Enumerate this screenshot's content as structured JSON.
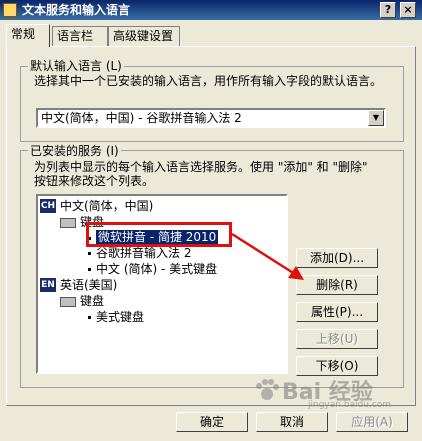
{
  "window": {
    "title": "文本服务和输入语言",
    "help_glyph": "?",
    "close_glyph": "×"
  },
  "tabs": [
    {
      "label": "常规",
      "active": true
    },
    {
      "label": "语言栏",
      "active": false
    },
    {
      "label": "高级键设置",
      "active": false
    }
  ],
  "default_group": {
    "label": "默认输入语言 (L)",
    "description": "选择其中一个已安装的输入语言，用作所有输入字段的默认语言。",
    "combo_value": "中文(简体，中国) - 谷歌拼音输入法 2"
  },
  "installed_group": {
    "label": "已安装的服务 (I)",
    "description_line1": "为列表中显示的每个输入语言选择服务。使用 \"添加\" 和 \"删除\"",
    "description_line2": "按钮来修改这个列表。"
  },
  "tree": {
    "lang1_code": "CH",
    "lang1": "中文(简体，中国)",
    "keyboard_label": "键盘",
    "items1": [
      "微软拼音 - 简捷 2010",
      "谷歌拼音输入法 2",
      "中文 (简体) - 美式键盘"
    ],
    "lang2_code": "EN",
    "lang2": "英语(美国)",
    "keyboard_label2": "键盘",
    "items2": [
      "美式键盘"
    ]
  },
  "buttons": {
    "add": "添加(D)...",
    "remove": "删除(R)",
    "properties": "属性(P)...",
    "move_up": "上移(U)",
    "move_down": "下移(O)",
    "ok": "确定",
    "cancel": "取消",
    "apply": "应用(A)"
  },
  "watermark": {
    "text": "Bai 经验",
    "sub": "jingyan.baidu.com"
  },
  "colors": {
    "annotation": "#e01010",
    "selection": "#0a246a",
    "titlebar": "#0a246a"
  }
}
